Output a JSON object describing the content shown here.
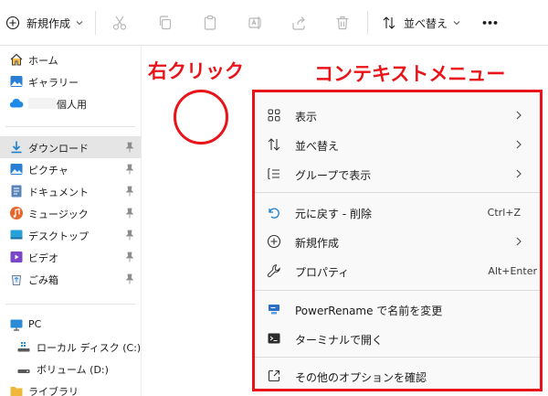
{
  "toolbar": {
    "new_label": "新規作成",
    "sort_label": "並べ替え",
    "more_label": "•••"
  },
  "sidebar": {
    "home": "ホーム",
    "gallery": "ギャラリー",
    "onedrive": "個人用",
    "downloads": "ダウンロード",
    "pictures": "ピクチャ",
    "documents": "ドキュメント",
    "music": "ミュージック",
    "desktop": "デスクトップ",
    "videos": "ビデオ",
    "recycle": "ごみ箱",
    "pc": "PC",
    "local_disk": "ローカル ディスク (C:)",
    "volume_d": "ボリューム (D:)",
    "library": "ライブラリ"
  },
  "annotations": {
    "right_click": "右クリック",
    "context_menu": "コンテキストメニュー",
    "accent_color": "#e8141a"
  },
  "menu": {
    "view": "表示",
    "sort": "並べ替え",
    "group": "グループで表示",
    "undo": "元に戻す - 削除",
    "undo_shortcut": "Ctrl+Z",
    "new": "新規作成",
    "properties": "プロパティ",
    "properties_shortcut": "Alt+Enter",
    "powerrename": "PowerRename で名前を変更",
    "terminal": "ターミナルで開く",
    "more_options": "その他のオプションを確認"
  }
}
